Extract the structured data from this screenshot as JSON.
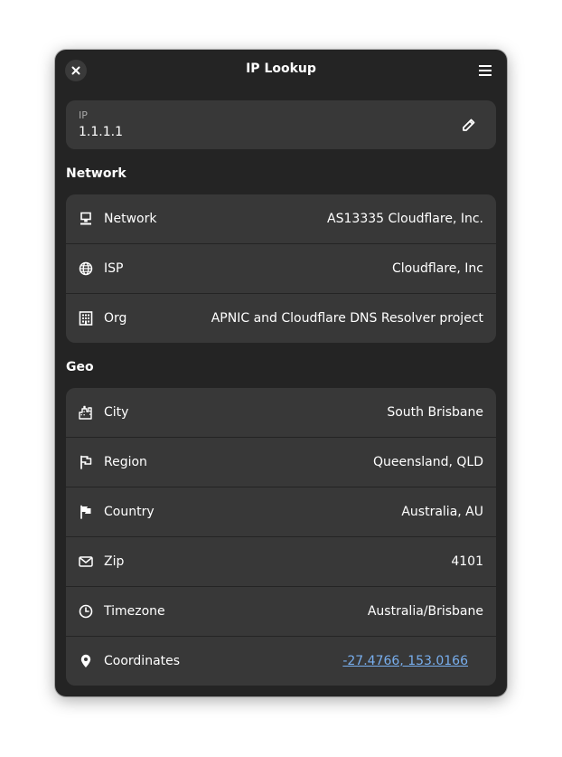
{
  "window": {
    "title": "IP Lookup"
  },
  "ip": {
    "label": "IP",
    "value": "1.1.1.1"
  },
  "network": {
    "section_title": "Network",
    "rows": [
      {
        "icon": "network-icon",
        "label": "Network",
        "value": "AS13335 Cloudflare, Inc."
      },
      {
        "icon": "globe-icon",
        "label": "ISP",
        "value": "Cloudflare, Inc"
      },
      {
        "icon": "building-icon",
        "label": "Org",
        "value": "APNIC and Cloudflare DNS Resolver project"
      }
    ]
  },
  "geo": {
    "section_title": "Geo",
    "rows": [
      {
        "icon": "city-icon",
        "label": "City",
        "value": "South Brisbane"
      },
      {
        "icon": "flag-outline-icon",
        "label": "Region",
        "value": "Queensland, QLD"
      },
      {
        "icon": "flag-filled-icon",
        "label": "Country",
        "value": "Australia, AU"
      },
      {
        "icon": "mail-icon",
        "label": "Zip",
        "value": "4101"
      },
      {
        "icon": "clock-icon",
        "label": "Timezone",
        "value": "Australia/Brisbane"
      },
      {
        "icon": "location-pin-icon",
        "label": "Coordinates",
        "value": "-27.4766, 153.0166"
      }
    ]
  },
  "colors": {
    "window_bg": "#242424",
    "card_bg": "#383838",
    "link": "#78aeed"
  }
}
